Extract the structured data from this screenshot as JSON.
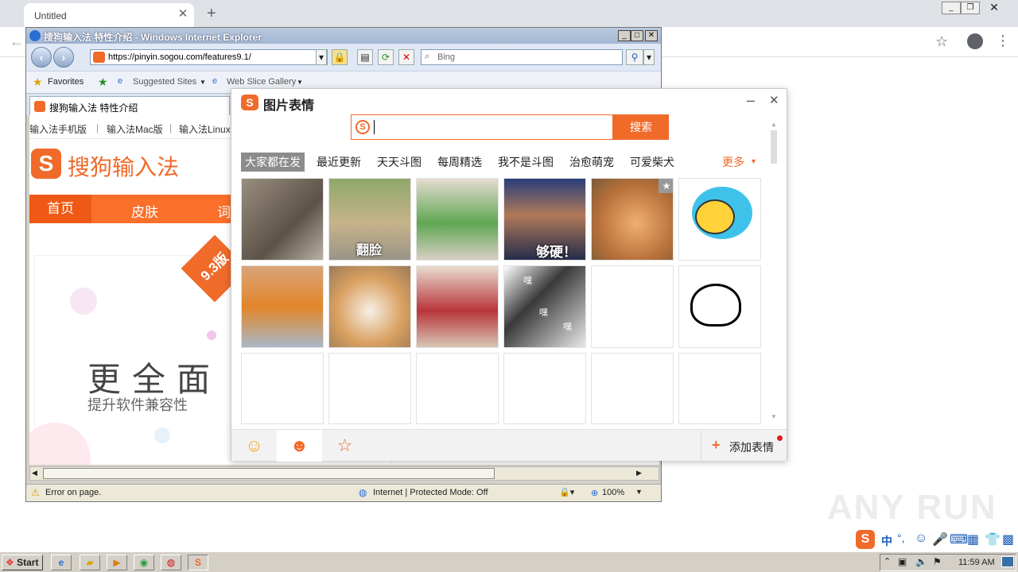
{
  "chrome": {
    "tab_title": "Untitled",
    "tab_close": "✕",
    "new_tab": "+"
  },
  "ie": {
    "title": "搜狗输入法 特性介绍 - Windows Internet Explorer",
    "url": "https://pinyin.sogou.com/features9.1/",
    "search_placeholder": "Bing",
    "favorites": "Favorites",
    "suggested": "Suggested Sites",
    "webslice": "Web Slice Gallery",
    "tab_title": "搜狗输入法 特性介绍",
    "status_error": "Error on page.",
    "status_zone": "Internet | Protected Mode: Off",
    "zoom": "100%"
  },
  "site": {
    "top_links": [
      "输入法手机版",
      "输入法Mac版",
      "输入法Linux"
    ],
    "logo": "搜狗输入法",
    "nav": [
      "首页",
      "皮肤",
      "词"
    ],
    "ribbon": "9.3版",
    "hero_title": "更全面",
    "hero_sub": "提升软件兼容性"
  },
  "popup": {
    "title": "图片表情",
    "search_button": "搜索",
    "search_value": "",
    "categories": [
      "大家都在发",
      "最近更新",
      "天天斗图",
      "每周精选",
      "我不是斗图",
      "治愈萌宠",
      "可爱柴犬"
    ],
    "more": "更多",
    "captions": {
      "c2": "翻脸",
      "c4": "够硬！",
      "c10": "嘿"
    },
    "add_label": "添加表情"
  },
  "taskbar": {
    "start": "Start",
    "time": "11:59 AM",
    "ime_lang": "中"
  },
  "watermark": "ANY RUN"
}
